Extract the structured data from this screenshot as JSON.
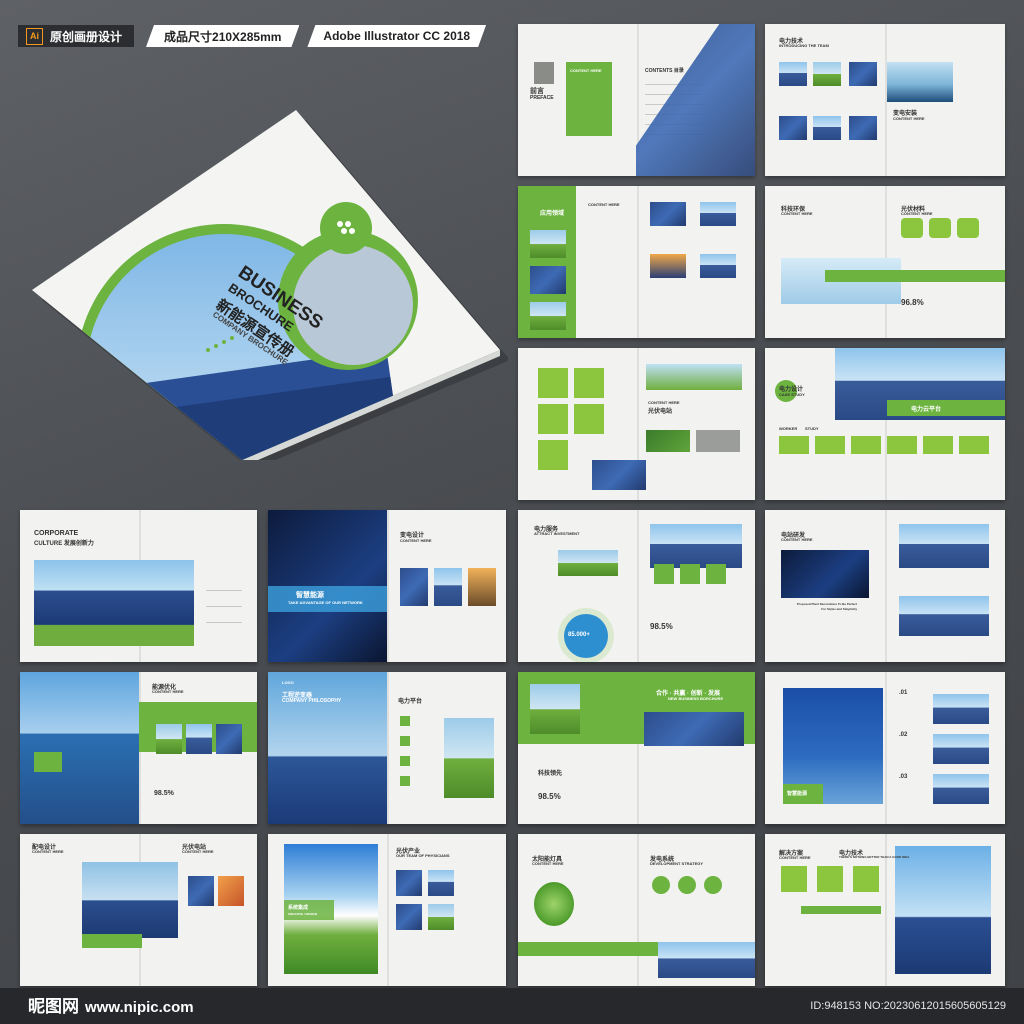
{
  "header": {
    "tag1": "原创画册设计",
    "ai_icon": "Ai",
    "tag2": "成品尺寸210X285mm",
    "tag3": "Adobe Illustrator CC 2018"
  },
  "cover": {
    "title": "BUSINESS",
    "subtitle": "BROCHURE",
    "cn_title": "新能源宣传册",
    "company": "COMPANY BROCHURE"
  },
  "spreads": {
    "s1": {
      "left_title": "前言",
      "left_sub": "PREFACE",
      "contents": "CONTENTS 目录",
      "content_here": "CONTENT HERE"
    },
    "s2": {
      "title": "电力技术",
      "sub": "INTRODUCING THE TEAM",
      "t2": "变电安装",
      "t2sub": "CONTENT HERE"
    },
    "s3": {
      "title": "应用领域",
      "sub": "CONTENT HERE"
    },
    "s4": {
      "title": "科技环保",
      "sub": "CONTENT HERE",
      "t2": "光伏材料",
      "t2sub": "CONTENT HERE",
      "pct": "96.8%"
    },
    "s5": {
      "title": "CONTENT HERE",
      "t2": "光伏电站"
    },
    "s6": {
      "title": "电力设计",
      "sub": "CASE STUDY",
      "banner": "电力云平台",
      "worker": "WORKER",
      "study": "STUDY"
    },
    "s7": {
      "title": "CORPORATE",
      "sub": "CULTURE 发展创新力"
    },
    "s8": {
      "title": "智慧能源",
      "sub": "TAKE ADVANTAGE OF OUR NETWORK",
      "t2": "变电设计",
      "t2sub": "CONTENT HERE"
    },
    "s9": {
      "title": "电力服务",
      "sub": "ATTRACT INVESTMENT",
      "num1": "85.000+",
      "pct": "98.5%"
    },
    "s10": {
      "title": "电站研发",
      "sub": "CONTENT HERE",
      "note": "Proposed Plant Decorations To Be Perfect For Styles and Simplicity"
    },
    "s11": {
      "title": "能源优化",
      "sub": "CONTENT HERE",
      "pct": "98.5%"
    },
    "s12": {
      "title": "工程逆变器",
      "sub": "COMPANY PHILOSOPHY",
      "t2": "电力平台",
      "logo": "LOGO"
    },
    "s13": {
      "title": "合作 · 共赢 · 创新 · 发展",
      "sub": "NEW BUSINESS BORCHURE",
      "t2": "科技领先",
      "pct": "98.5%"
    },
    "s14": {
      "title": "智慧能源",
      "n1": ".01",
      "n2": ".02",
      "n3": ".03"
    },
    "s15": {
      "title": "配电设计",
      "sub": "CONTENT HERE",
      "t2": "光伏电站",
      "t2sub": "CONTENT HERE"
    },
    "s16": {
      "title": "系统集成",
      "sub": "CREATIVE / DESIGN",
      "t2": "光伏产业",
      "t2sub": "OUR TEAM OF PHYSICIANS"
    },
    "s17": {
      "title": "太阳能灯具",
      "sub": "CONTENT HERE",
      "t2": "发电系统",
      "t2sub": "DEVELOPMENT STRATEGY"
    },
    "s18": {
      "title": "解决方案",
      "sub": "CONTENT HERE",
      "t2": "电力技术",
      "t2sub": "THERE'S NOTHING BETTER THAN A GOOD IDEA"
    }
  },
  "footer": {
    "logo": "昵图网",
    "url": "www.nipic.com",
    "id": "ID:948153 NO:20230612015605605129"
  },
  "colors": {
    "accent": "#6cb33f",
    "accent_light": "#8cc63f",
    "bg": "#4f5256"
  }
}
